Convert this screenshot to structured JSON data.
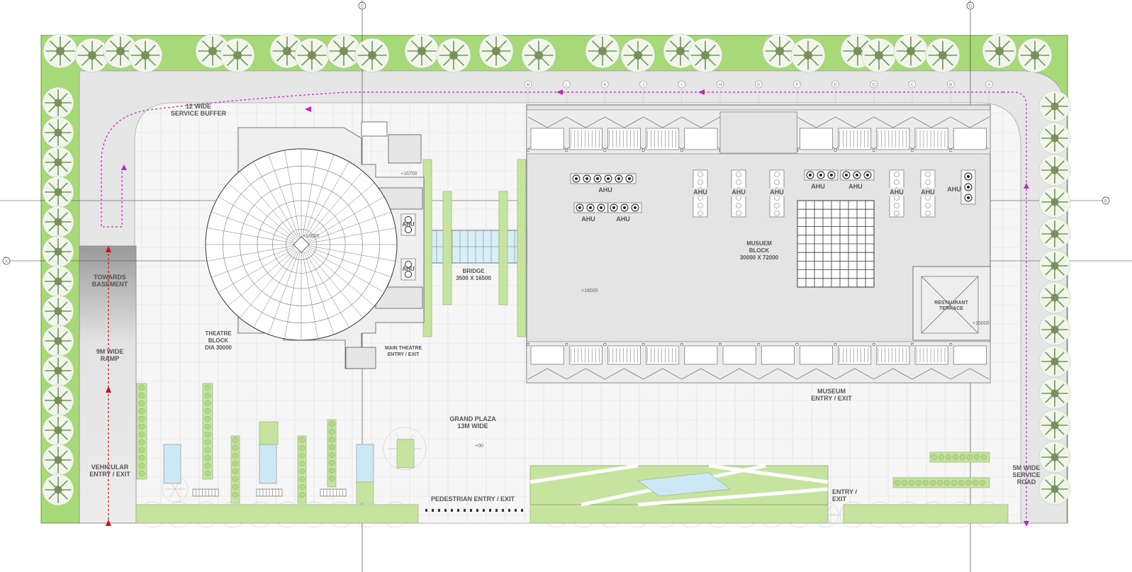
{
  "colors": {
    "landscape": "#a8d978",
    "landscape_edge": "#6d9a48",
    "road": "#e6e6e6",
    "plaza": "#f4f4f4",
    "building": "#e3e3e3",
    "line": "#777777",
    "dark": "#333333",
    "route": "#c026c0",
    "ramp_arrow": "#d01010",
    "water": "#cde8f4",
    "tree_olive": "#78905a"
  },
  "labels": {
    "service_buffer": [
      "12 WIDE",
      "SERVICE BUFFER"
    ],
    "towards_basement": [
      "TOWARDS",
      "BASEMENT"
    ],
    "ramp": [
      "9M WIDE",
      "RAMP"
    ],
    "vehicular": [
      "VEHICULAR",
      "ENTRY / EXIT"
    ],
    "theatre": [
      "THEATRE",
      "BLOCK",
      "DIA 30000"
    ],
    "main_theatre": [
      "MAIN THEATRE",
      "ENTRY / EXIT"
    ],
    "bridge": [
      "BRIDGE",
      "3500 X 16500"
    ],
    "museum_block": [
      "MUSUEM",
      "BLOCK",
      "30000 X 72000"
    ],
    "restaurant": [
      "RESTAURANT",
      "TERRACE"
    ],
    "museum_entry": [
      "MUSEUM",
      "ENTRY / EXIT"
    ],
    "grand_plaza": [
      "GRAND PLAZA",
      "13M WIDE"
    ],
    "pedestrian": "PEDESTRIAN ENTRY / EXIT",
    "entry_exit": [
      "ENTRY /",
      "EXIT"
    ],
    "service_road": [
      "5M WIDE",
      "SERVICE",
      "ROAD"
    ],
    "ahu": "AHU"
  },
  "grid_markers": {
    "top": [
      "C",
      "D"
    ],
    "side": [
      "A",
      "B"
    ],
    "columns": [
      "M",
      "L",
      "K",
      "J",
      "I",
      "H",
      "G",
      "F",
      "E",
      "D",
      "C",
      "B",
      "A"
    ]
  },
  "levels": [
    "+16700",
    "+18000",
    "+15000",
    "+13000",
    "+00"
  ]
}
